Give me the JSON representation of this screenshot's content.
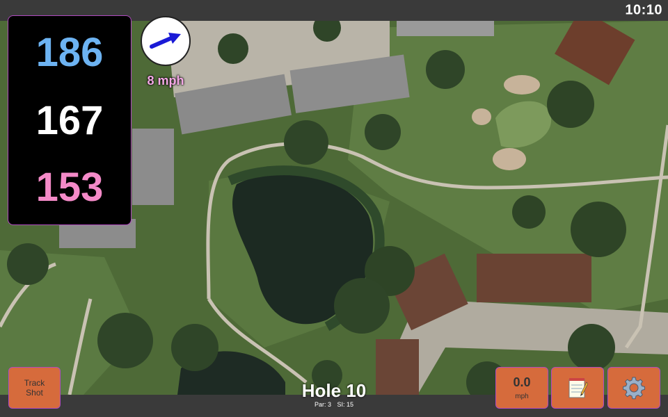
{
  "status_bar": {
    "time": "10:10"
  },
  "distances": {
    "back": "186",
    "middle": "167",
    "front": "153"
  },
  "wind": {
    "speed_label": "8 mph",
    "direction_icon": "wind-arrow-icon"
  },
  "buttons": {
    "track_shot_line1": "Track",
    "track_shot_line2": "Shot",
    "speed_value": "0.0",
    "speed_unit": "mph",
    "notes_icon": "notepad-icon",
    "settings_icon": "gear-icon"
  },
  "hole": {
    "title": "Hole 10",
    "par": "Par: 3",
    "si": "SI: 15"
  },
  "colors": {
    "back_distance": "#6db3f2",
    "middle_distance": "#ffffff",
    "front_distance": "#f48ac8",
    "button_bg": "#d66b3c",
    "wind_label": "#f5a8e6"
  }
}
